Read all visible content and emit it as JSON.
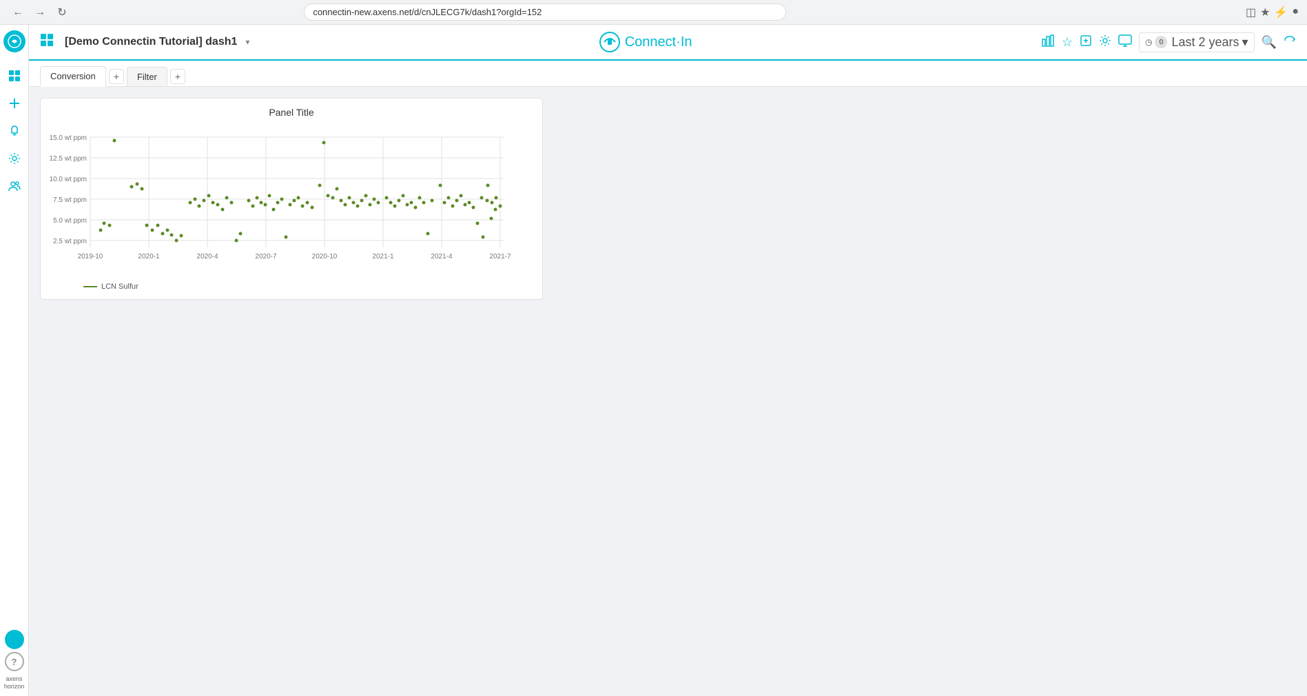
{
  "browser": {
    "url": "connectin-new.axens.net/d/cnJLECG7k/dash1?orgId=152",
    "back_icon": "←",
    "forward_icon": "→",
    "reload_icon": "↻"
  },
  "topnav": {
    "dashboard_title": "[Demo Connectin Tutorial] dash1",
    "title_caret": "▾",
    "brand_name": "Connect·In",
    "time_filter_count": "0",
    "time_filter_label": "Last 2 years",
    "time_filter_caret": "▾"
  },
  "tabs": [
    {
      "label": "Conversion",
      "active": true
    },
    {
      "label": "Filter",
      "active": false
    }
  ],
  "chart": {
    "title": "Panel Title",
    "y_axis": [
      "15.0 wt ppm",
      "12.5 wt ppm",
      "10.0 wt ppm",
      "7.5 wt ppm",
      "5.0 wt ppm",
      "2.5 wt ppm"
    ],
    "x_axis": [
      "2019-10",
      "2020-1",
      "2020-4",
      "2020-7",
      "2020-10",
      "2021-1",
      "2021-4",
      "2021-7"
    ],
    "legend_label": "LCN Sulfur"
  },
  "sidebar": {
    "items": [
      "grid",
      "plus",
      "bell",
      "settings",
      "people"
    ],
    "brand": "axens\nhorizon"
  }
}
